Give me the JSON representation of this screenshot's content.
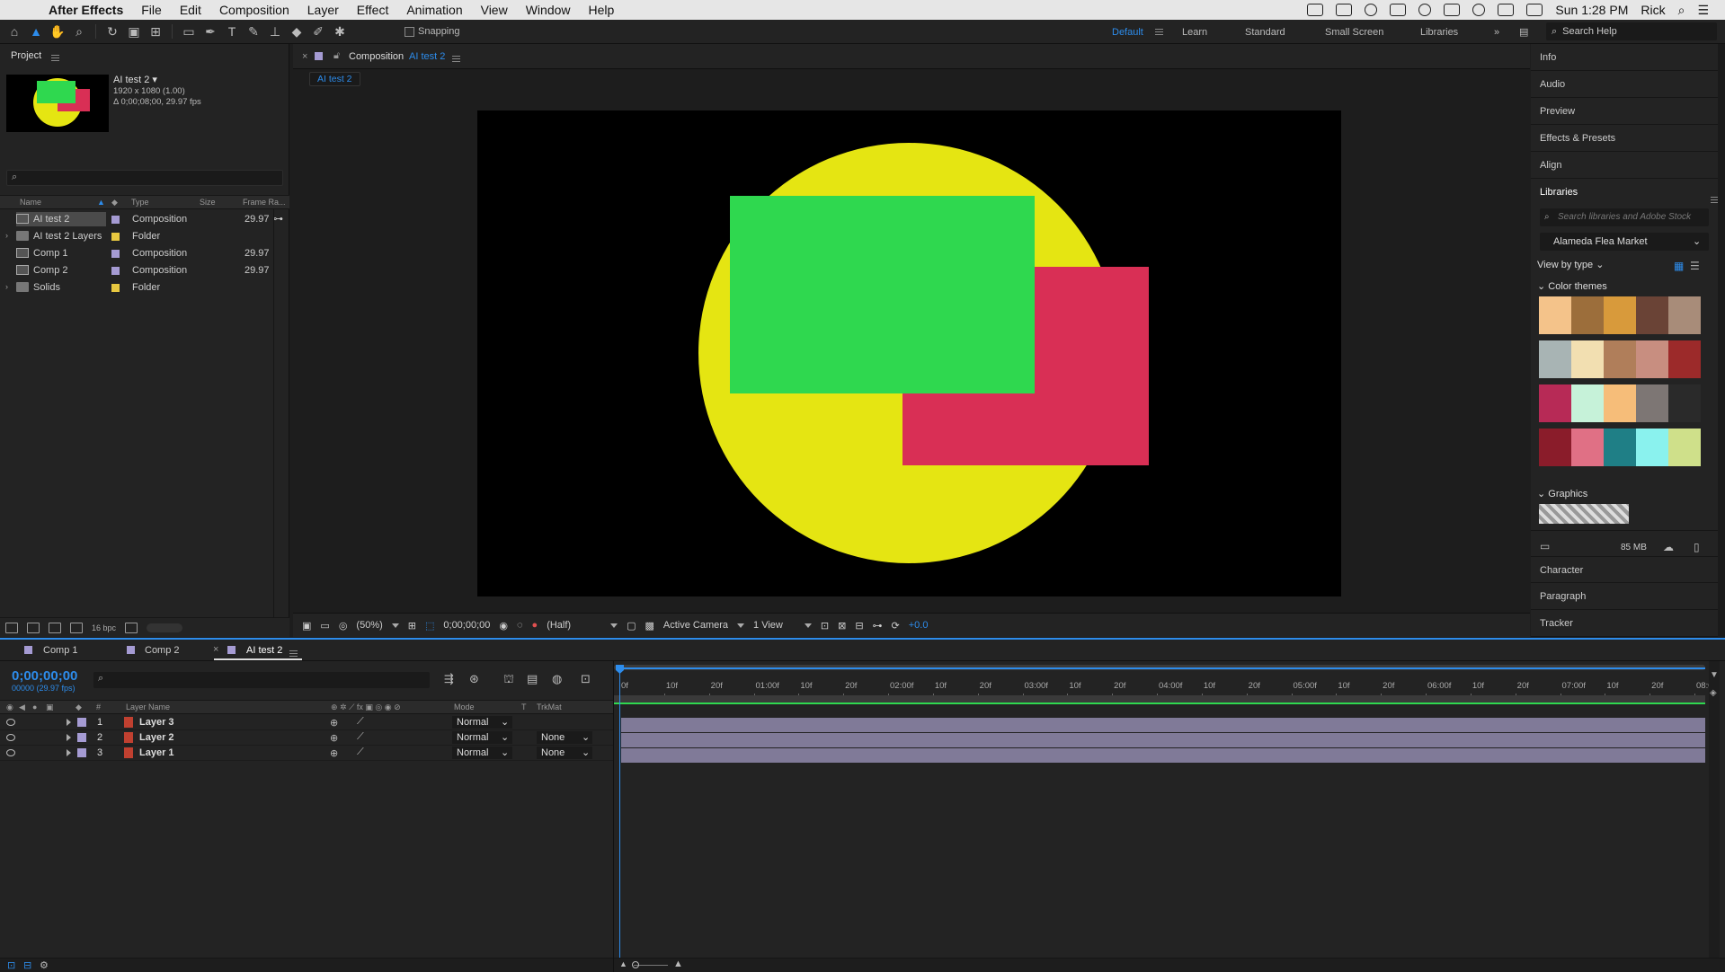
{
  "menubar": {
    "app": "After Effects",
    "items": [
      "File",
      "Edit",
      "Composition",
      "Layer",
      "Effect",
      "Animation",
      "View",
      "Window",
      "Help"
    ],
    "clock": "Sun 1:28 PM",
    "user": "Rick"
  },
  "toolbar": {
    "snapping": "Snapping",
    "workspaces": [
      "Default",
      "Learn",
      "Standard",
      "Small Screen",
      "Libraries"
    ],
    "search_help": "Search Help"
  },
  "project": {
    "title": "Project",
    "selected_name": "AI test 2 ▾",
    "info1": "1920 x 1080 (1.00)",
    "info2": "Δ 0;00;08;00, 29.97 fps",
    "columns": [
      "Name",
      "Type",
      "Size",
      "Frame Ra..."
    ],
    "items": [
      {
        "name": "AI test 2",
        "type": "Composition",
        "fps": "29.97",
        "label": "#a59bd3",
        "kind": "comp"
      },
      {
        "name": "AI test 2 Layers",
        "type": "Folder",
        "fps": "",
        "label": "#e8c840",
        "kind": "folder"
      },
      {
        "name": "Comp 1",
        "type": "Composition",
        "fps": "29.97",
        "label": "#a59bd3",
        "kind": "comp"
      },
      {
        "name": "Comp 2",
        "type": "Composition",
        "fps": "29.97",
        "label": "#a59bd3",
        "kind": "comp"
      },
      {
        "name": "Solids",
        "type": "Folder",
        "fps": "",
        "label": "#e8c840",
        "kind": "folder"
      }
    ],
    "bpc": "16 bpc"
  },
  "viewer": {
    "tab_prefix": "Composition",
    "tab_name": "AI test 2",
    "sub_tab": "AI test 2",
    "zoom": "(50%)",
    "timecode": "0;00;00;00",
    "resolution": "(Half)",
    "camera": "Active Camera",
    "views": "1 View",
    "exposure": "+0.0"
  },
  "right_panel": {
    "items_top": [
      "Info",
      "Audio",
      "Preview",
      "Effects & Presets",
      "Align"
    ],
    "libraries": "Libraries",
    "lib_search": "Search libraries and Adobe Stock",
    "lib_select": "Alameda Flea Market",
    "view_by": "View by type",
    "color_themes": "Color themes",
    "graphics": "Graphics",
    "storage": "85 MB",
    "items_bottom": [
      "Character",
      "Paragraph",
      "Tracker"
    ]
  },
  "swatches": [
    [
      "#f4c38a",
      "#9c6e3b",
      "#d89a3b",
      "#6a4336",
      "#a88c79"
    ],
    [
      "#a8b4b4",
      "#f2dfb1",
      "#b07e5a",
      "#c88e80",
      "#9c2a2a"
    ],
    [
      "#b72a56",
      "#c6f2d9",
      "#f6bd79",
      "#7d7674",
      "#2a2a2a"
    ],
    [
      "#8a1c2a",
      "#e07085",
      "#1f7f86",
      "#8af2ee",
      "#cfe08a"
    ]
  ],
  "timeline": {
    "tabs": [
      "Comp 1",
      "Comp 2",
      "AI test 2"
    ],
    "timecode": "0;00;00;00",
    "timecode_sub": "00000 (29.97 fps)",
    "col_layer_name": "Layer Name",
    "col_mode": "Mode",
    "col_t": "T",
    "col_trkmat": "TrkMat",
    "col_hash": "#",
    "layers": [
      {
        "num": "1",
        "name": "Layer 3",
        "mode": "Normal",
        "trkmat": ""
      },
      {
        "num": "2",
        "name": "Layer 2",
        "mode": "Normal",
        "trkmat": "None"
      },
      {
        "num": "3",
        "name": "Layer 1",
        "mode": "Normal",
        "trkmat": "None"
      }
    ],
    "ruler": [
      "0f",
      "10f",
      "20f",
      "01:00f",
      "10f",
      "20f",
      "02:00f",
      "10f",
      "20f",
      "03:00f",
      "10f",
      "20f",
      "04:00f",
      "10f",
      "20f",
      "05:00f",
      "10f",
      "20f",
      "06:00f",
      "10f",
      "20f",
      "07:00f",
      "10f",
      "20f",
      "08:0"
    ]
  },
  "composition": {
    "background": "#000000",
    "circle_color": "#e5e512",
    "green_color": "#2fd84f",
    "red_color": "#d92f55"
  }
}
